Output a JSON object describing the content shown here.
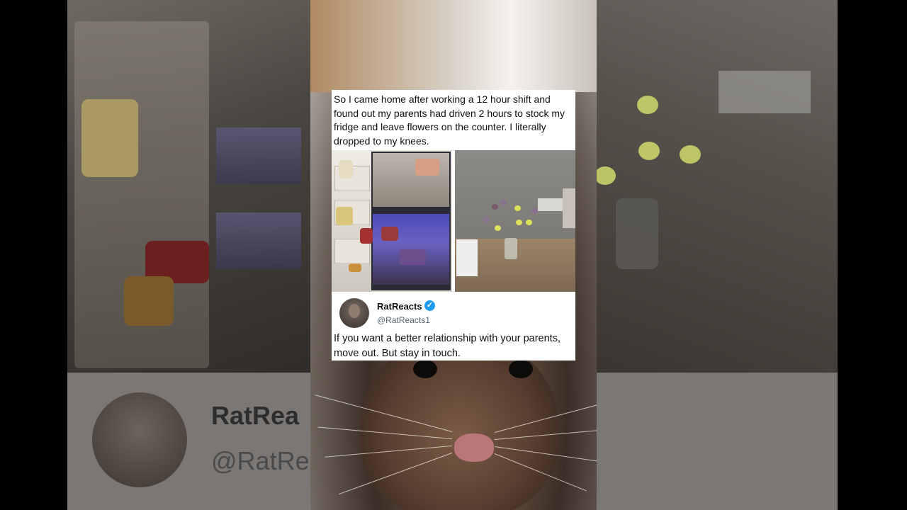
{
  "post": {
    "caption": "So I came home after working a 12 hour shift and found out my parents had driven 2 hours to stock my fridge and leave flowers on the counter. I literally dropped to my knees."
  },
  "tweet": {
    "display_name": "RatReacts",
    "handle": "@RatReacts1",
    "verified_icon": "check-badge",
    "text": "If you want a better relationship with your parents, move out. But stay in touch."
  },
  "background": {
    "name_fragment": "RatRea",
    "handle_fragment": "@RatRe"
  },
  "colors": {
    "verified": "#1d9bf0",
    "card": "#ffffff"
  }
}
